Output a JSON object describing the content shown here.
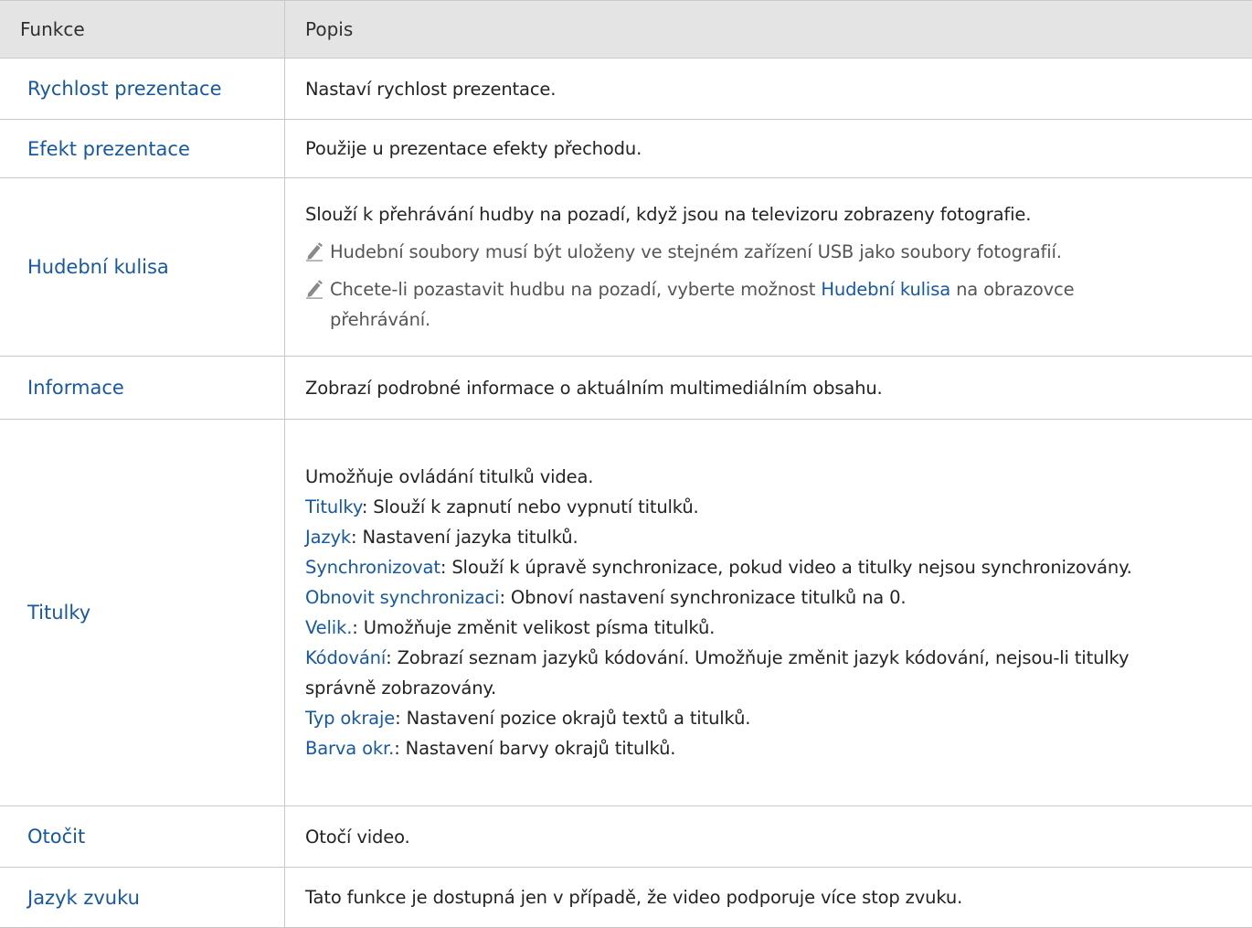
{
  "header": {
    "col1": "Funkce",
    "col2": "Popis"
  },
  "rows": {
    "r0": {
      "name": "Rychlost prezentace",
      "desc": "Nastaví rychlost prezentace."
    },
    "r1": {
      "name": "Efekt prezentace",
      "desc": "Použije u prezentace efekty přechodu."
    },
    "r2": {
      "name": "Hudební kulisa",
      "desc": "Slouží k přehrávání hudby na pozadí, když jsou na televizoru zobrazeny fotografie.",
      "note1": "Hudební soubory musí být uloženy ve stejném zařízení USB jako soubory fotografií.",
      "note2_before": "Chcete-li pozastavit hudbu na pozadí, vyberte možnost ",
      "note2_link": "Hudební kulisa",
      "note2_after": " na obrazovce",
      "note2_cont": "přehrávání."
    },
    "r3": {
      "name": "Informace",
      "desc": "Zobrazí podrobné informace o aktuálním multimediálním obsahu."
    },
    "r4": {
      "name": "Titulky",
      "intro": "Umožňuje ovládání titulků videa.",
      "items": [
        {
          "term": "Titulky",
          "text": ": Slouží k zapnutí nebo vypnutí titulků."
        },
        {
          "term": "Jazyk",
          "text": ": Nastavení jazyka titulků."
        },
        {
          "term": "Synchronizovat",
          "text": ": Slouží k úpravě synchronizace, pokud video a titulky nejsou synchronizovány."
        },
        {
          "term": "Obnovit synchronizaci",
          "text": ": Obnoví nastavení synchronizace titulků na 0."
        },
        {
          "term": "Velik.",
          "text": ": Umožňuje změnit velikost písma titulků."
        },
        {
          "term": "Kódování",
          "text": ": Zobrazí seznam jazyků kódování. Umožňuje změnit jazyk kódování, nejsou-li titulky",
          "cont": "správně zobrazovány."
        },
        {
          "term": "Typ okraje",
          "text": ": Nastavení pozice okrajů textů a titulků."
        },
        {
          "term": "Barva okr.",
          "text": ": Nastavení barvy okrajů titulků."
        }
      ]
    },
    "r5": {
      "name": "Otočit",
      "desc": "Otočí video."
    },
    "r6": {
      "name": "Jazyk zvuku",
      "desc": "Tato funkce je dostupná jen v případě, že video podporuje více stop zvuku."
    }
  },
  "icons": {
    "note": "pencil-icon"
  },
  "colors": {
    "link": "#1658a6",
    "header_bg": "#e4e4e4",
    "border": "#c8c8c8"
  }
}
